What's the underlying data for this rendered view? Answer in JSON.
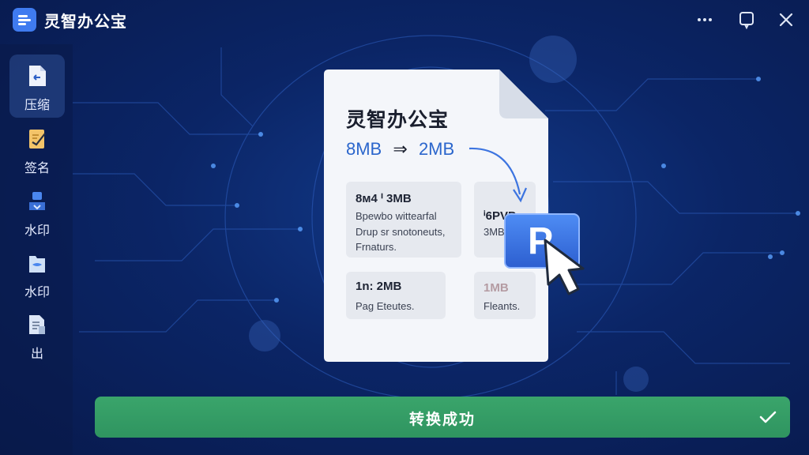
{
  "app": {
    "title": "灵智办公宝"
  },
  "window_controls": [
    {
      "icon": "more-dots-icon"
    },
    {
      "icon": "restore-icon"
    },
    {
      "icon": "close-icon"
    }
  ],
  "sidebar": {
    "items": [
      {
        "label": "压缩",
        "icon": "compress-file-icon",
        "active": true
      },
      {
        "label": "签名",
        "icon": "sign-icon",
        "active": false
      },
      {
        "label": "水印",
        "icon": "watermark-icon",
        "active": false
      },
      {
        "label": "水印",
        "icon": "watermark-folder-icon",
        "active": false
      },
      {
        "label": "出",
        "icon": "export-file-icon",
        "active": false
      }
    ]
  },
  "document": {
    "title": "灵智办公宝",
    "size_from": "8MB",
    "size_arrow": "⇒",
    "size_to": "2MB",
    "tiles": [
      {
        "line1": "8ᴍ4 ᑊ 3MB",
        "line2": "Bpewbo wittearfal",
        "line3": "Drup sr snotoneuts,",
        "line4": "Frnaturs."
      },
      {
        "line1": "ⁱ6PVP",
        "line2": "3MB"
      },
      {
        "line1": "1n: 2MB",
        "line2": "Pag Eteutes."
      },
      {
        "line1": "1MB",
        "line2": "Fleants."
      }
    ]
  },
  "badge": {
    "letter": "P"
  },
  "status": {
    "text": "转换成功",
    "icon": "checkmark-icon"
  },
  "colors": {
    "background": "#0b2566",
    "accent": "#3f7bf0",
    "success": "#36a068",
    "size_text": "#2b66cc"
  }
}
